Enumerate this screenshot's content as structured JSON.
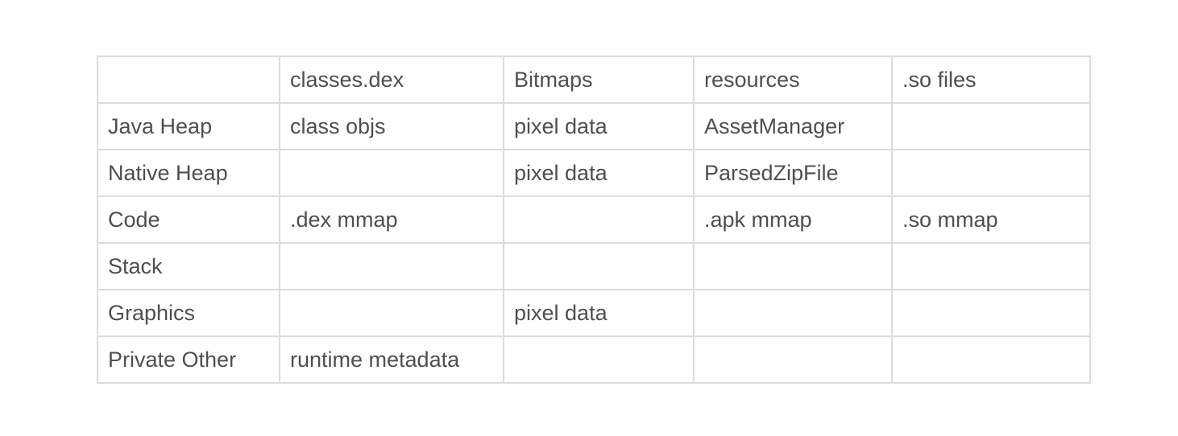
{
  "table": {
    "header": [
      "",
      "classes.dex",
      "Bitmaps",
      "resources",
      ".so files"
    ],
    "rows": [
      [
        "Java Heap",
        "class objs",
        "pixel data",
        "AssetManager",
        ""
      ],
      [
        "Native Heap",
        "",
        "pixel data",
        "ParsedZipFile",
        ""
      ],
      [
        "Code",
        ".dex mmap",
        "",
        ".apk mmap",
        ".so mmap"
      ],
      [
        "Stack",
        "",
        "",
        "",
        ""
      ],
      [
        "Graphics",
        "",
        "pixel data",
        "",
        ""
      ],
      [
        "Private Other",
        "runtime metadata",
        "",
        "",
        ""
      ]
    ]
  }
}
